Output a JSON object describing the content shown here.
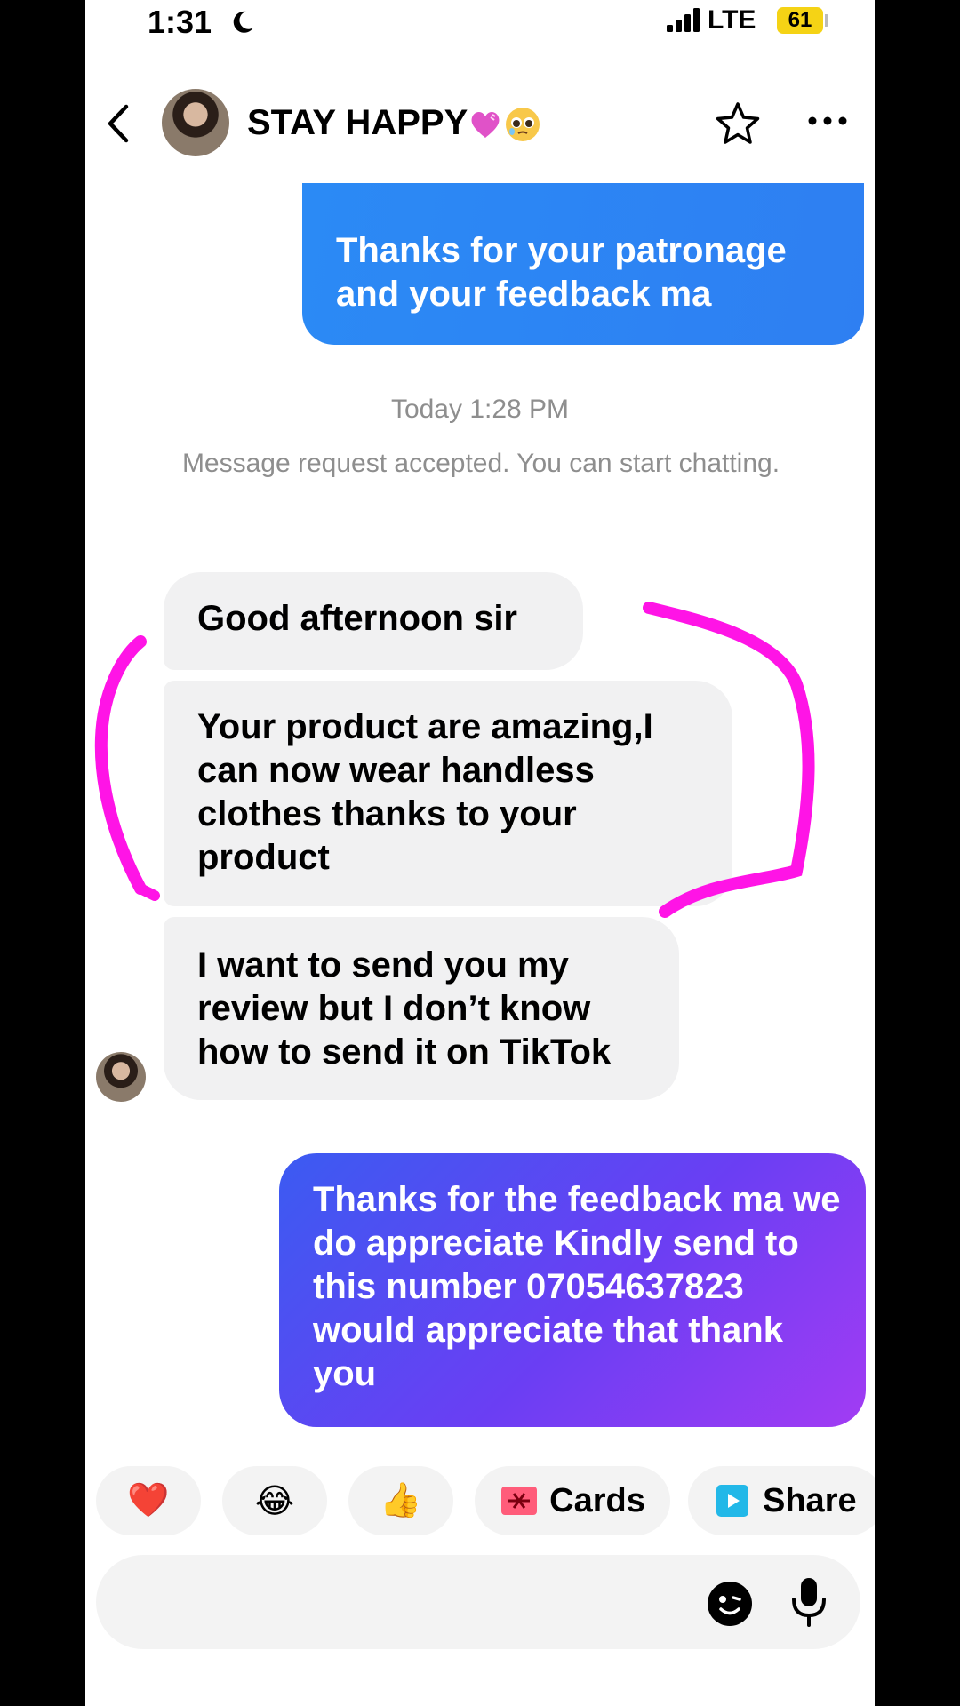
{
  "status_bar": {
    "time": "1:31",
    "network": "LTE",
    "battery": "61"
  },
  "header": {
    "title": "STAY HAPPY"
  },
  "messages": {
    "outgoing_1": "Thanks for your patronage and your feedback ma",
    "timestamp": "Today 1:28 PM",
    "system_notice": "Message request accepted. You can start chatting.",
    "incoming_1": "Good afternoon sir",
    "incoming_2": "Your product are amazing,I can now wear handless clothes thanks to your product",
    "incoming_3": "I want to send you my review but I don’t know how to send it on TikTok",
    "outgoing_2": "Thanks for the feedback ma we do appreciate Kindly send to this number 07054637823 would appreciate that thank you"
  },
  "quick_actions": {
    "heart": "❤️",
    "laugh": "😂",
    "thumbs_up": "👍",
    "cards_label": "Cards",
    "share_label": "Share"
  },
  "composer": {
    "placeholder": ""
  },
  "colors": {
    "outgoing_blue": "#2e7ff2",
    "outgoing_purple": "#a23cf3",
    "annotation_magenta": "#ff14e6",
    "incoming_bg": "#f1f1f2"
  },
  "icons": {
    "back": "back-chevron-icon",
    "star": "star-outline-icon",
    "more": "more-dots-icon",
    "sticker": "sticker-face-icon",
    "mic": "microphone-icon"
  }
}
